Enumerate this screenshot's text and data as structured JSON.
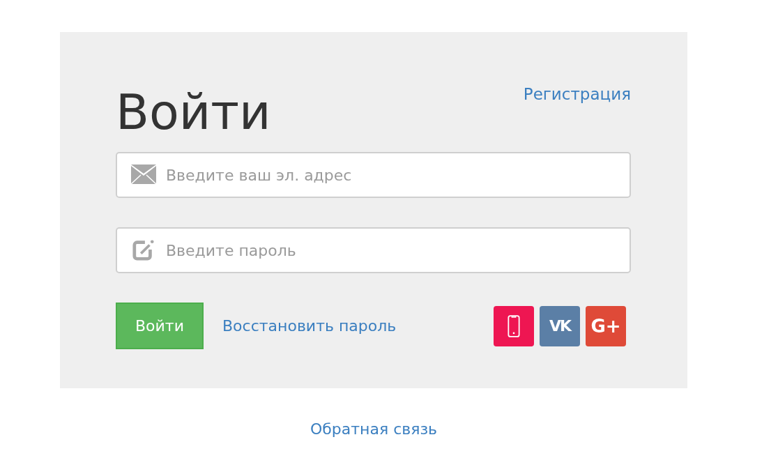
{
  "title": "Войти",
  "register_link": "Регистрация",
  "fields": [
    {
      "kind": "email",
      "placeholder": "Введите ваш эл. адрес"
    },
    {
      "kind": "password",
      "placeholder": "Введите пароль"
    }
  ],
  "submit_button": "Войти",
  "recover_link": "Восстановить пароль",
  "social_buttons": [
    {
      "kind": "phone",
      "color": "#ee1652"
    },
    {
      "kind": "vk",
      "label": "VK",
      "color": "#5b7fa6"
    },
    {
      "kind": "google",
      "label": "G+",
      "color": "#df4a38"
    }
  ],
  "feedback_link": "Обратная связь"
}
